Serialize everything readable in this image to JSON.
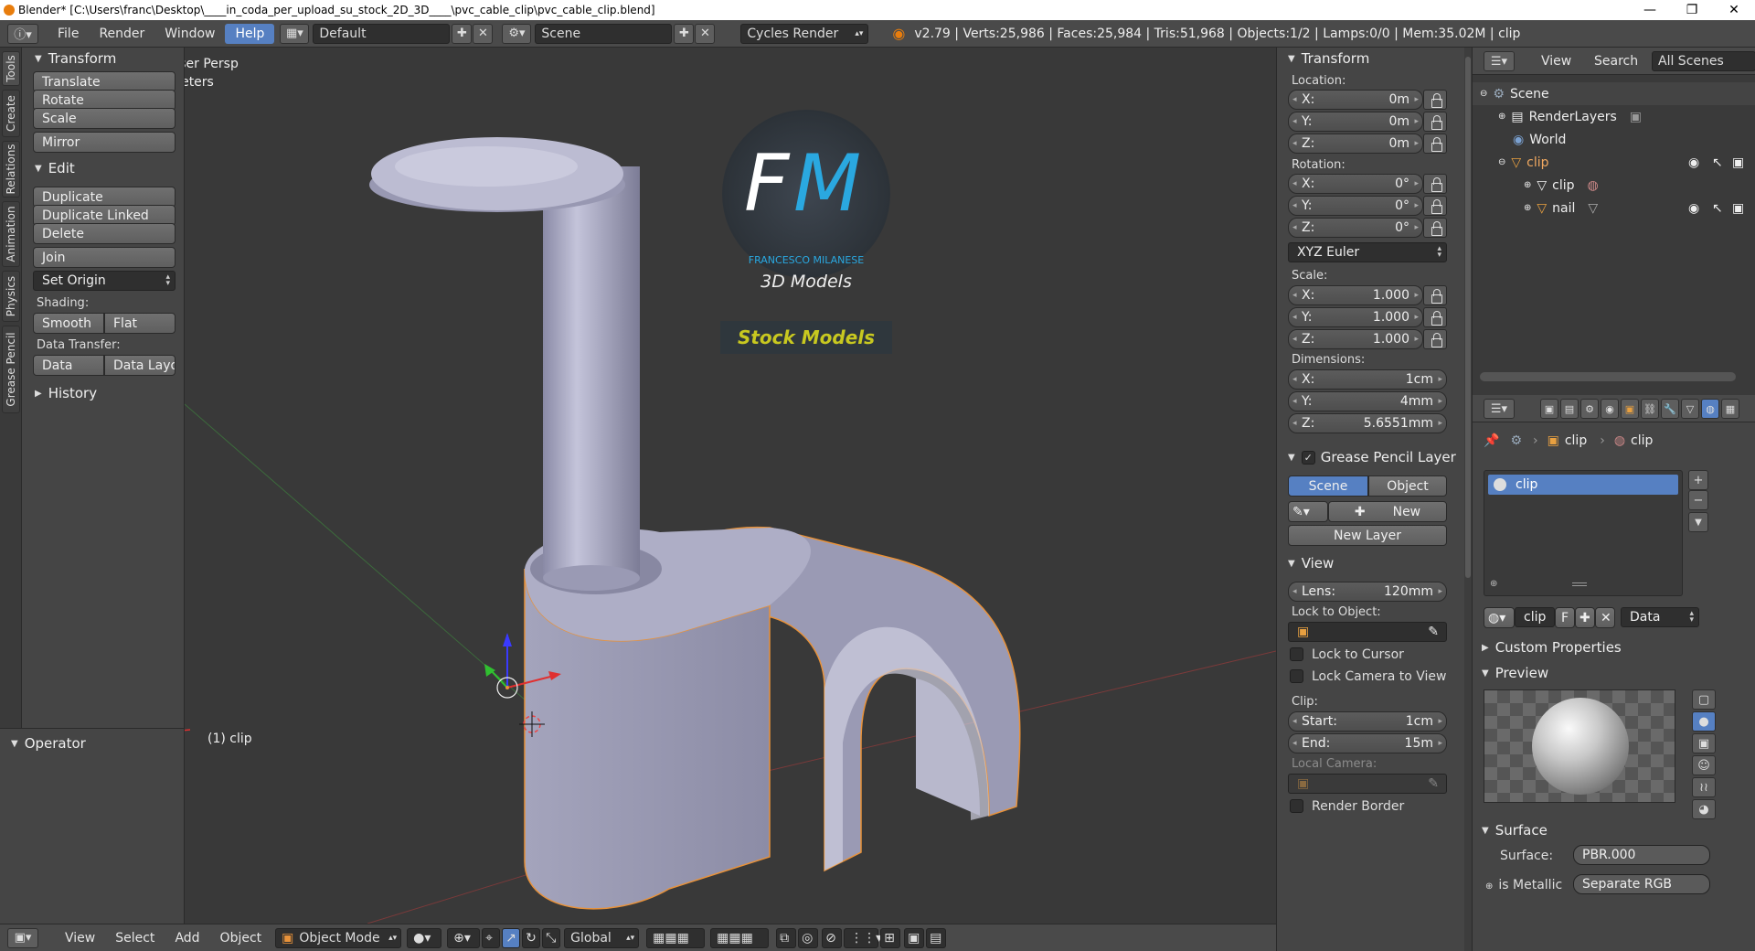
{
  "window": {
    "title": "Blender* [C:\\Users\\franc\\Desktop\\____in_coda_per_upload_su_stock_2D_3D____\\pvc_cable_clip\\pvc_cable_clip.blend]",
    "minimize": "—",
    "maximize": "❐",
    "close": "✕"
  },
  "infobar": {
    "menus": [
      "File",
      "Render",
      "Window",
      "Help"
    ],
    "active_menu": "Help",
    "screen_layout": "Default",
    "scene": "Scene",
    "render_engine": "Cycles Render",
    "stats": "v2.79 | Verts:25,986 | Faces:25,984 | Tris:51,968 | Objects:1/2 | Lamps:0/0 | Mem:35.02M | clip"
  },
  "vertical_tabs": [
    "Tools",
    "Create",
    "Relations",
    "Animation",
    "Physics",
    "Grease Pencil"
  ],
  "toolshelf": {
    "transform": {
      "title": "Transform",
      "buttons": [
        "Translate",
        "Rotate",
        "Scale",
        "Mirror"
      ]
    },
    "edit": {
      "title": "Edit",
      "buttons": [
        "Duplicate",
        "Duplicate Linked",
        "Delete",
        "Join"
      ],
      "set_origin": "Set Origin",
      "shading_label": "Shading:",
      "smooth": "Smooth",
      "flat": "Flat",
      "data_transfer_label": "Data Transfer:",
      "data": "Data",
      "data_layout": "Data Layo"
    },
    "history": "History",
    "operator": "Operator"
  },
  "viewport": {
    "view_name": "User Persp",
    "units": "Meters",
    "object_label": "(1) clip",
    "watermark": {
      "letters": "FM",
      "author": "FRANCESCO MILANESE",
      "line": "3D Models",
      "banner": "Stock Models"
    },
    "colors": {
      "background": "#393939",
      "model": "#b3b3cc",
      "selection": "#e8923a",
      "logo_f": "#ffffff",
      "logo_m": "#2aa8e0",
      "banner_text": "#c8c820"
    }
  },
  "bottombar": {
    "menus": [
      "View",
      "Select",
      "Add",
      "Object"
    ],
    "mode": "Object Mode",
    "orientation": "Global"
  },
  "npanel": {
    "transform_title": "Transform",
    "location_label": "Location:",
    "location": [
      {
        "axis": "X:",
        "value": "0m"
      },
      {
        "axis": "Y:",
        "value": "0m"
      },
      {
        "axis": "Z:",
        "value": "0m"
      }
    ],
    "rotation_label": "Rotation:",
    "rotation": [
      {
        "axis": "X:",
        "value": "0°"
      },
      {
        "axis": "Y:",
        "value": "0°"
      },
      {
        "axis": "Z:",
        "value": "0°"
      }
    ],
    "rotation_mode": "XYZ Euler",
    "scale_label": "Scale:",
    "scale": [
      {
        "axis": "X:",
        "value": "1.000"
      },
      {
        "axis": "Y:",
        "value": "1.000"
      },
      {
        "axis": "Z:",
        "value": "1.000"
      }
    ],
    "dimensions_label": "Dimensions:",
    "dimensions": [
      {
        "axis": "X:",
        "value": "1cm"
      },
      {
        "axis": "Y:",
        "value": "4mm"
      },
      {
        "axis": "Z:",
        "value": "5.6551mm"
      }
    ],
    "grease_title": "Grease Pencil Layer",
    "grease_scene": "Scene",
    "grease_object": "Object",
    "grease_new": "New",
    "grease_new_layer": "New Layer",
    "view_title": "View",
    "lens_label": "Lens:",
    "lens_value": "120mm",
    "lock_to_object": "Lock to Object:",
    "lock_to_cursor": "Lock to Cursor",
    "lock_camera": "Lock Camera to View",
    "clip_label": "Clip:",
    "clip_start_label": "Start:",
    "clip_start": "1cm",
    "clip_end_label": "End:",
    "clip_end": "15m",
    "local_camera": "Local Camera:",
    "render_border": "Render Border"
  },
  "outliner": {
    "view": "View",
    "search": "Search",
    "filter": "All Scenes",
    "rows": [
      {
        "label": "Scene"
      },
      {
        "label": "RenderLayers"
      },
      {
        "label": "World"
      },
      {
        "label": "clip"
      },
      {
        "label": "clip"
      },
      {
        "label": "nail"
      }
    ]
  },
  "properties": {
    "breadcrumb": [
      "clip",
      "clip"
    ],
    "material_slot": "clip",
    "material_name": "clip",
    "material_f": "F",
    "link_mode": "Data",
    "custom_properties": "Custom Properties",
    "preview": "Preview",
    "surface_title": "Surface",
    "surface_label": "Surface:",
    "surface_value": "PBR.000",
    "is_metallic": "is Metallic",
    "is_metallic_value": "Separate RGB"
  }
}
